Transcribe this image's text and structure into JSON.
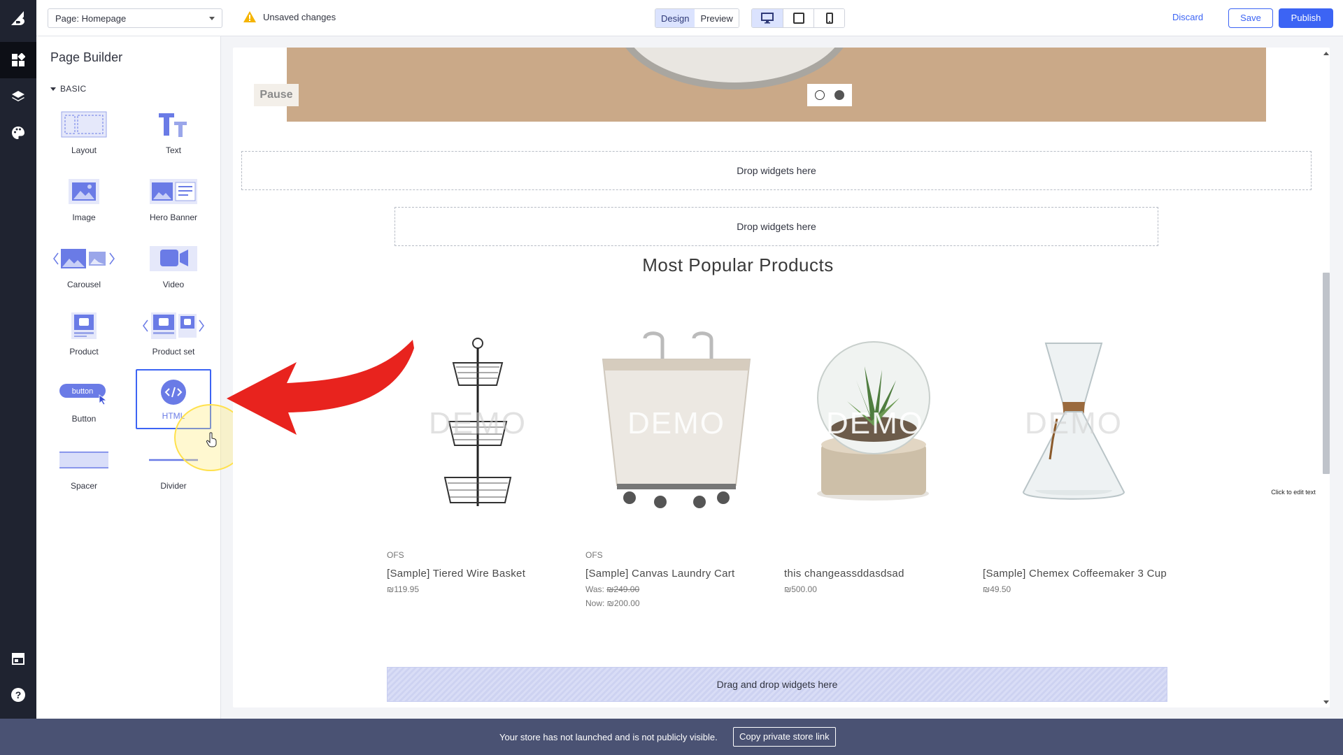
{
  "topbar": {
    "page_select": "Page: Homepage",
    "unsaved": "Unsaved changes",
    "modes": [
      "Design",
      "Preview"
    ],
    "devices": [
      "desktop-icon",
      "tablet-icon",
      "mobile-icon"
    ],
    "discard": "Discard",
    "save": "Save",
    "publish": "Publish"
  },
  "rail": {
    "items": [
      "widgets-icon",
      "layers-icon",
      "palette-icon",
      "storefront-icon",
      "help-icon"
    ]
  },
  "sidebar": {
    "title": "Page Builder",
    "section": "BASIC",
    "widgets": [
      {
        "label": "Layout",
        "icon": "layout-icon"
      },
      {
        "label": "Text",
        "icon": "text-icon"
      },
      {
        "label": "Image",
        "icon": "image-icon"
      },
      {
        "label": "Hero Banner",
        "icon": "hero-banner-icon"
      },
      {
        "label": "Carousel",
        "icon": "carousel-icon"
      },
      {
        "label": "Video",
        "icon": "video-icon"
      },
      {
        "label": "Product",
        "icon": "product-icon"
      },
      {
        "label": "Product set",
        "icon": "product-set-icon"
      },
      {
        "label": "Button",
        "icon": "button-icon",
        "icon_text": "button"
      },
      {
        "label": "HTML",
        "icon": "html-icon"
      },
      {
        "label": "Spacer",
        "icon": "spacer-icon"
      },
      {
        "label": "Divider",
        "icon": "divider-icon"
      }
    ]
  },
  "canvas": {
    "pause": "Pause",
    "drop_zone_1": "Drop widgets here",
    "drop_zone_2": "Drop widgets here",
    "section_title": "Most Popular Products",
    "demo_watermark": "DEMO",
    "edit_tip": "Click to edit text",
    "products": [
      {
        "brand": "OFS",
        "name": "[Sample] Tiered Wire Basket",
        "price": "₪119.95"
      },
      {
        "brand": "OFS",
        "name": "[Sample] Canvas Laundry Cart",
        "was_label": "Was:",
        "was_price": "₪249.00",
        "now": "Now: ₪200.00"
      },
      {
        "brand": "",
        "name": "this changeassddasdsad",
        "price": "₪500.00"
      },
      {
        "brand": "",
        "name": "[Sample] Chemex Coffeemaker 3 Cup",
        "price": "₪49.50"
      }
    ],
    "drag_zone": "Drag and drop widgets here"
  },
  "bottom_bar": {
    "message": "Your store has not launched and is not publicly visible.",
    "copy_link": "Copy private store link"
  },
  "colors": {
    "accent": "#3c64f4",
    "rail": "#1f2330",
    "banner": "#4a5273",
    "hero": "#caa988",
    "arrow": "#e8231e"
  }
}
